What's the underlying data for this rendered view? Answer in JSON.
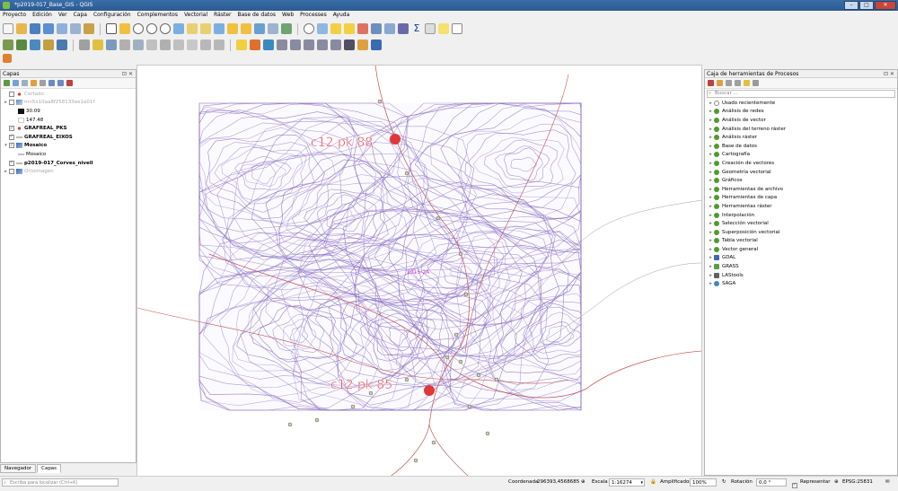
{
  "window": {
    "title": "*p2019-017_Base_GIS - QGIS"
  },
  "menu": [
    "Proyecto",
    "Edición",
    "Ver",
    "Capa",
    "Configuración",
    "Complementos",
    "Vectorial",
    "Ráster",
    "Base de datos",
    "Web",
    "Processes",
    "Ayuda"
  ],
  "layers_panel": {
    "title": "Capas",
    "items": [
      {
        "label": "Cortado",
        "checked": false,
        "disabled": true,
        "expander": "",
        "icon": "point-layer-icon",
        "bold": false,
        "indent": 0
      },
      {
        "label": "mn5x10aa8f258133ee1e01f",
        "checked": false,
        "disabled": true,
        "expander": "▸",
        "icon": "raster-layer-icon",
        "bold": false,
        "indent": 0
      },
      {
        "label": "30.09",
        "checked": null,
        "disabled": false,
        "expander": "",
        "icon": "legend-dark-swatch",
        "bold": false,
        "indent": 1
      },
      {
        "label": "147.48",
        "checked": null,
        "disabled": false,
        "expander": "",
        "icon": "legend-light-swatch",
        "bold": false,
        "indent": 1
      },
      {
        "label": "GRAFREAL_PKS",
        "checked": true,
        "disabled": false,
        "expander": "",
        "icon": "point-layer-icon",
        "bold": true,
        "indent": 0
      },
      {
        "label": "GRAFREAL_EIXOS",
        "checked": true,
        "disabled": false,
        "expander": "",
        "icon": "line-layer-icon",
        "bold": true,
        "indent": 0
      },
      {
        "label": "Mosaico",
        "checked": true,
        "disabled": false,
        "expander": "▾",
        "icon": "group-icon",
        "bold": true,
        "indent": 0
      },
      {
        "label": "Mosaico",
        "checked": null,
        "disabled": false,
        "expander": "",
        "icon": "line-legend-icon",
        "bold": false,
        "indent": 1
      },
      {
        "label": "p2019-017_Corves_nivell",
        "checked": true,
        "disabled": false,
        "expander": "",
        "icon": "line-layer-icon",
        "bold": true,
        "indent": 0
      },
      {
        "label": "Ortoimagen",
        "checked": false,
        "disabled": true,
        "expander": "▸",
        "icon": "group-icon",
        "bold": false,
        "indent": 0
      }
    ]
  },
  "map": {
    "labels": [
      {
        "text": "c12 pk 88"
      },
      {
        "text": "c12 pk 85"
      }
    ],
    "center_label": "2015-2A",
    "colors": {
      "contours": "#8a6fc0",
      "roads": "#c0504d",
      "markers": "#e03838"
    }
  },
  "processing_panel": {
    "title": "Caja de herramientas de Procesos",
    "search_placeholder": "Buscar ...",
    "items": [
      {
        "label": "Usado recientemente",
        "icon": "clock-icon"
      },
      {
        "label": "Análisis de redes",
        "icon": "qgis-icon"
      },
      {
        "label": "Análisis de vector",
        "icon": "qgis-icon"
      },
      {
        "label": "Análisis del terreno ráster",
        "icon": "qgis-icon"
      },
      {
        "label": "Análisis ráster",
        "icon": "qgis-icon"
      },
      {
        "label": "Base de datos",
        "icon": "qgis-icon"
      },
      {
        "label": "Cartografía",
        "icon": "qgis-icon"
      },
      {
        "label": "Creación de vectores",
        "icon": "qgis-icon"
      },
      {
        "label": "Geometría vectorial",
        "icon": "qgis-icon"
      },
      {
        "label": "Gráficos",
        "icon": "qgis-icon"
      },
      {
        "label": "Herramientas de archivo",
        "icon": "qgis-icon"
      },
      {
        "label": "Herramientas de capa",
        "icon": "qgis-icon"
      },
      {
        "label": "Herramientas ráster",
        "icon": "qgis-icon"
      },
      {
        "label": "Interpolación",
        "icon": "qgis-icon"
      },
      {
        "label": "Selección vectorial",
        "icon": "qgis-icon"
      },
      {
        "label": "Superposición vectorial",
        "icon": "qgis-icon"
      },
      {
        "label": "Tabla vectorial",
        "icon": "qgis-icon"
      },
      {
        "label": "Vector general",
        "icon": "qgis-icon"
      },
      {
        "label": "GDAL",
        "icon": "gdal-icon"
      },
      {
        "label": "GRASS",
        "icon": "grass-icon"
      },
      {
        "label": "LAStools",
        "icon": "lastools-icon"
      },
      {
        "label": "SAGA",
        "icon": "saga-icon"
      }
    ]
  },
  "tabs": [
    "Navegador",
    "Capas"
  ],
  "status": {
    "locator_placeholder": "Escriba para localizar (Ctrl+K)",
    "coord_label": "Coordenada",
    "coord_value": "296393,4568685",
    "scale_label": "Escala",
    "scale_value": "1:16274",
    "magnifier_label": "Amplificador",
    "magnifier_value": "100%",
    "rotation_label": "Rotación",
    "rotation_value": "0,0 °",
    "render_label": "Representar",
    "crs": "EPSG:25831"
  }
}
